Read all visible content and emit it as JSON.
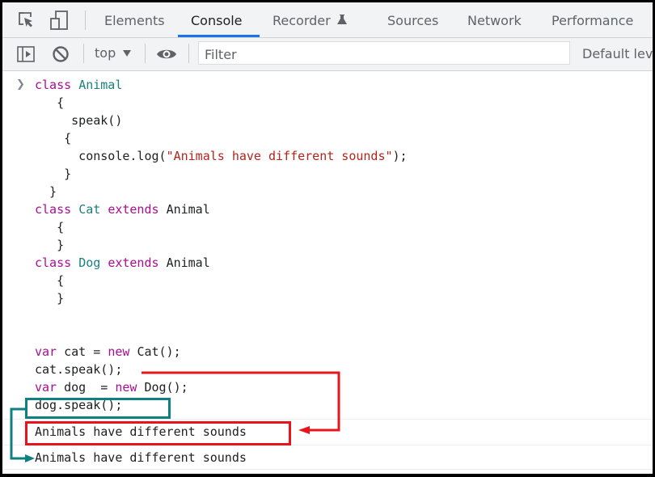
{
  "tabbar": {
    "tabs": [
      {
        "label": "Elements",
        "active": false
      },
      {
        "label": "Console",
        "active": true
      },
      {
        "label": "Recorder",
        "active": false,
        "icon": "flask-icon"
      },
      {
        "label": "Sources",
        "active": false
      },
      {
        "label": "Network",
        "active": false
      },
      {
        "label": "Performance",
        "active": false
      }
    ],
    "icons": [
      "inspect-element-icon",
      "device-toolbar-icon"
    ],
    "accent": "#1a73e8"
  },
  "toolbar": {
    "context": "top",
    "filter_placeholder": "Filter",
    "levels": "Default lev",
    "icons": [
      "sidebar-toggle-icon",
      "clear-console-icon",
      "dropdown-arrow-icon",
      "eye-icon"
    ]
  },
  "console": {
    "input_lines": [
      [
        {
          "t": "class ",
          "c": "kw"
        },
        {
          "t": "Animal",
          "c": "cls"
        }
      ],
      [
        {
          "t": "   {",
          "c": ""
        }
      ],
      [
        {
          "t": "     speak()",
          "c": ""
        }
      ],
      [
        {
          "t": "    {",
          "c": ""
        }
      ],
      [
        {
          "t": "      console.log(",
          "c": ""
        },
        {
          "t": "\"Animals have different sounds\"",
          "c": "str"
        },
        {
          "t": ");",
          "c": ""
        }
      ],
      [
        {
          "t": "    }",
          "c": ""
        }
      ],
      [
        {
          "t": "  }",
          "c": ""
        }
      ],
      [
        {
          "t": "class ",
          "c": "kw"
        },
        {
          "t": "Cat ",
          "c": "cls"
        },
        {
          "t": "extends ",
          "c": "kw"
        },
        {
          "t": "Animal",
          "c": ""
        }
      ],
      [
        {
          "t": "   {",
          "c": ""
        }
      ],
      [
        {
          "t": "   }",
          "c": ""
        }
      ],
      [
        {
          "t": "class ",
          "c": "kw"
        },
        {
          "t": "Dog ",
          "c": "cls"
        },
        {
          "t": "extends ",
          "c": "kw"
        },
        {
          "t": "Animal",
          "c": ""
        }
      ],
      [
        {
          "t": "   {",
          "c": ""
        }
      ],
      [
        {
          "t": "   }",
          "c": ""
        }
      ],
      [
        {
          "t": "",
          "c": ""
        }
      ],
      [
        {
          "t": "",
          "c": ""
        }
      ],
      [
        {
          "t": "var ",
          "c": "kw"
        },
        {
          "t": "cat = ",
          "c": ""
        },
        {
          "t": "new ",
          "c": "kw"
        },
        {
          "t": "Cat();",
          "c": ""
        }
      ],
      [
        {
          "t": "cat.speak();",
          "c": ""
        }
      ],
      [
        {
          "t": "var ",
          "c": "kw"
        },
        {
          "t": "dog  = ",
          "c": ""
        },
        {
          "t": "new ",
          "c": "kw"
        },
        {
          "t": "Dog();",
          "c": ""
        }
      ],
      [
        {
          "t": "dog.speak();",
          "c": ""
        }
      ]
    ],
    "outputs": [
      "Animals have different sounds",
      "Animals have different sounds"
    ]
  },
  "annotations": {
    "red": "#e8141b",
    "teal": "#0e8080"
  }
}
